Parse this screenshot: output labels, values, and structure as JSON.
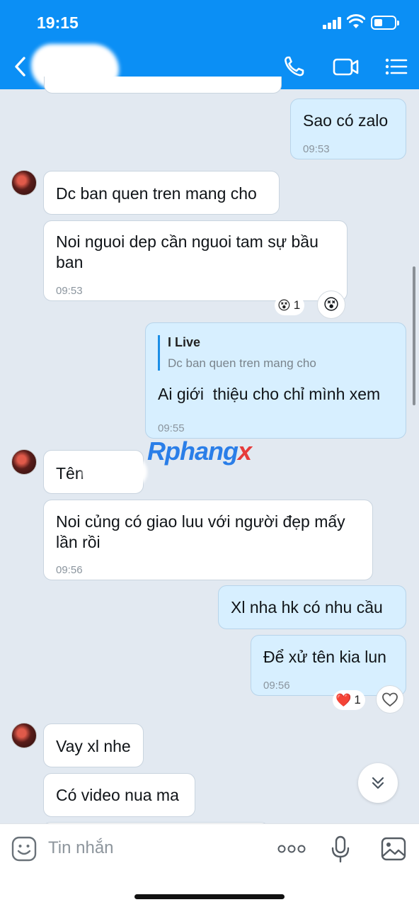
{
  "status_bar": {
    "time": "19:15"
  },
  "header": {
    "back_icon": "chevron-left-icon",
    "contact_name": "",
    "icons": [
      "phone-icon",
      "video-call-icon",
      "menu-list-icon"
    ],
    "accent_color": "#0b8ff5"
  },
  "messages": [
    {
      "side": "out",
      "text": "Sao có zalo",
      "time": "09:53"
    },
    {
      "side": "in",
      "text": "Dc ban quen tren mang cho"
    },
    {
      "side": "in",
      "text": "Noi nguoi dep cần nguoi tam sự bầu ban",
      "time": "09:53",
      "reaction": {
        "emoji": "😵",
        "count": "1"
      }
    },
    {
      "side": "out",
      "quote": {
        "name": "I Live",
        "text": "Dc ban quen tren mang cho"
      },
      "text": "Ai giới  thiệu cho chỉ mình xem",
      "time": "09:55"
    },
    {
      "side": "in",
      "text": "Tên"
    },
    {
      "side": "in",
      "text": "Noi củng có giao luu với người đẹp mấy lần rồi",
      "time": "09:56"
    },
    {
      "side": "out",
      "text": "Xl nha hk có nhu cầu"
    },
    {
      "side": "out",
      "text": "Để xử tên kia lun",
      "time": "09:56",
      "reaction": {
        "emoji": "❤️",
        "count": "1"
      }
    },
    {
      "side": "in",
      "text": "Vay xl nhe"
    },
    {
      "side": "in",
      "text": "Có video nua ma"
    }
  ],
  "watermark": {
    "part1": "Rphang",
    "part2": "x"
  },
  "input": {
    "placeholder": "Tin nhắn",
    "icons": [
      "sticker-icon",
      "more-icon",
      "microphone-icon",
      "image-icon"
    ]
  }
}
